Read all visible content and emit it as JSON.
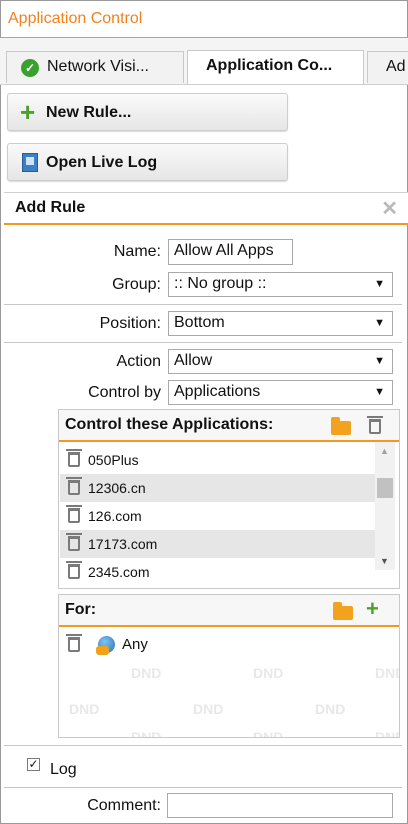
{
  "window": {
    "title": "Application Control"
  },
  "tabs": [
    {
      "label": "Network Visi..."
    },
    {
      "label": "Application Co..."
    },
    {
      "label": "Ad"
    }
  ],
  "toolbar": {
    "new_rule": "New Rule...",
    "open_live_log": "Open Live Log"
  },
  "panel": {
    "title": "Add Rule"
  },
  "form": {
    "name_label": "Name:",
    "name_value": "Allow All Apps",
    "group_label": "Group:",
    "group_value": ":: No group ::",
    "position_label": "Position:",
    "position_value": "Bottom",
    "action_label": "Action",
    "action_value": "Allow",
    "control_by_label": "Control by",
    "control_by_value": "Applications"
  },
  "applications_box": {
    "title": "Control these Applications:",
    "items": [
      "050Plus",
      "12306.cn",
      "126.com",
      "17173.com",
      "2345.com"
    ]
  },
  "for_box": {
    "title": "For:",
    "items": [
      "Any"
    ],
    "watermark": "DND"
  },
  "log": {
    "label": "Log",
    "checked": true
  },
  "comment": {
    "label": "Comment:",
    "value": ""
  },
  "colors": {
    "accent": "#f29a1e",
    "title_text": "#f0821e",
    "green": "#4ca12d"
  }
}
